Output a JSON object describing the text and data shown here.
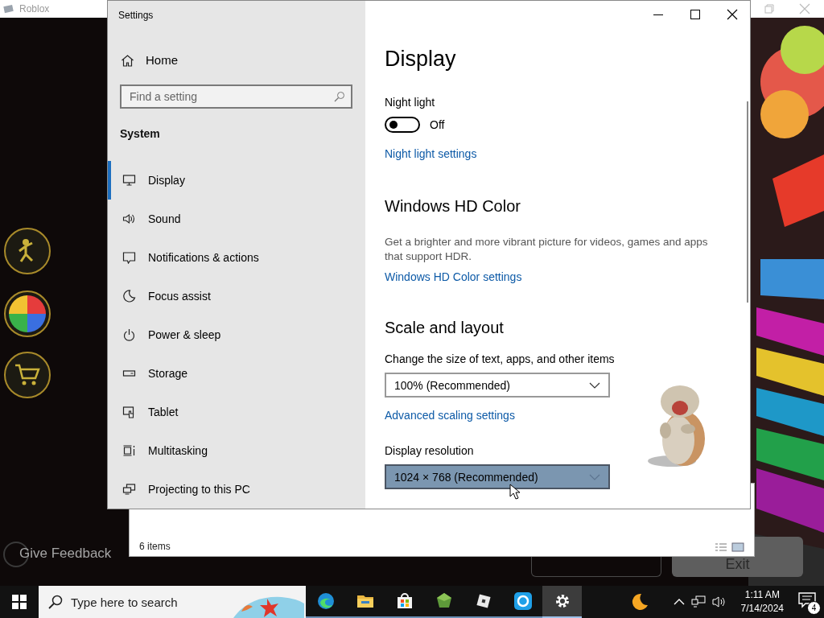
{
  "roblox_window": {
    "title": "Roblox",
    "feedback_label": "Give Feedback",
    "exit_button": "Exit"
  },
  "explorer_window": {
    "status_text": "6 items"
  },
  "settings_window": {
    "title": "Settings",
    "home": "Home",
    "search": {
      "placeholder": "Find a setting"
    },
    "section": "System",
    "nav_items": [
      {
        "label": "Display",
        "selected": true
      },
      {
        "label": "Sound",
        "selected": false
      },
      {
        "label": "Notifications & actions",
        "selected": false
      },
      {
        "label": "Focus assist",
        "selected": false
      },
      {
        "label": "Power & sleep",
        "selected": false
      },
      {
        "label": "Storage",
        "selected": false
      },
      {
        "label": "Tablet",
        "selected": false
      },
      {
        "label": "Multitasking",
        "selected": false
      },
      {
        "label": "Projecting to this PC",
        "selected": false
      }
    ],
    "content": {
      "heading": "Display",
      "night_light": {
        "label": "Night light",
        "on": false,
        "state_text": "Off",
        "link": "Night light settings"
      },
      "hd_color": {
        "heading": "Windows HD Color",
        "description": "Get a brighter and more vibrant picture for videos, games and apps that support HDR.",
        "link": "Windows HD Color settings"
      },
      "scale": {
        "heading": "Scale and layout",
        "size_label": "Change the size of text, apps, and other items",
        "size_value": "100% (Recommended)",
        "link": "Advanced scaling settings",
        "resolution_label": "Display resolution",
        "resolution_value": "1024 × 768 (Recommended)",
        "resolution_hovered": true
      }
    }
  },
  "taskbar": {
    "search_placeholder": "Type here to search",
    "apps": [
      {
        "selected": false
      },
      {
        "selected": false
      },
      {
        "selected": false
      },
      {
        "selected": false
      },
      {
        "selected": false
      },
      {
        "selected": false
      },
      {
        "selected": true
      }
    ],
    "time": "1:11 AM",
    "date": "7/14/2024",
    "notification_count": "4"
  }
}
